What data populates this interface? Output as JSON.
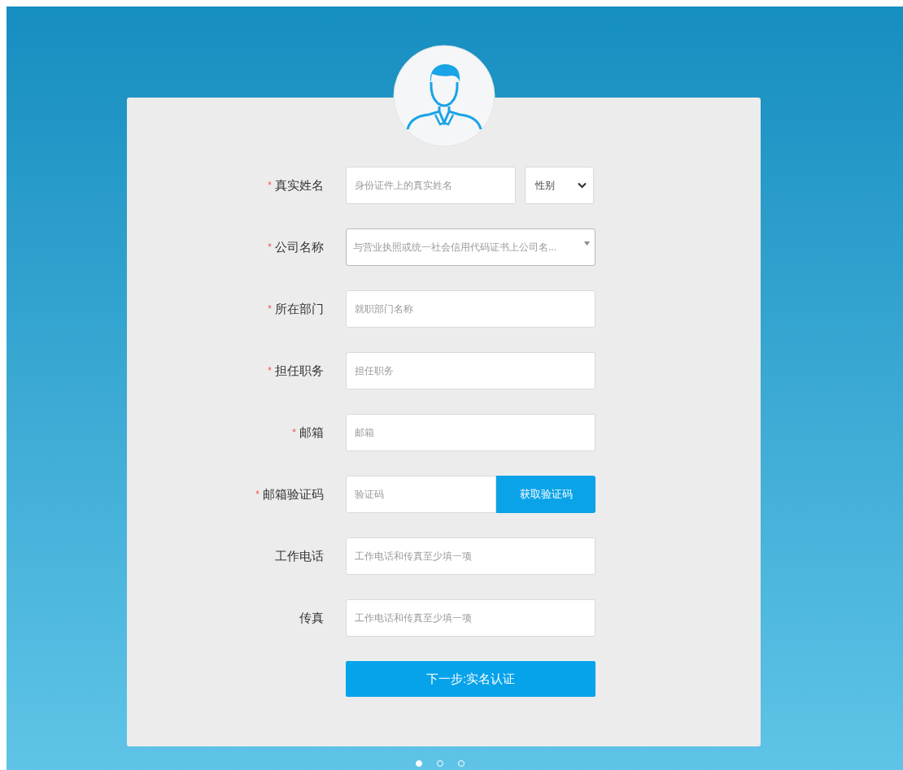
{
  "form": {
    "rows": [
      {
        "kind": "name",
        "marker": "*",
        "label": "真实姓名",
        "placeholder": "身份证件上的真实姓名",
        "select": "性别"
      },
      {
        "kind": "combo",
        "marker": "*",
        "label": "公司名称",
        "placeholder": "与营业执照或统一社会信用代码证书上公司名..."
      },
      {
        "kind": "text",
        "marker": "*",
        "label": "所在部门",
        "placeholder": "就职部门名称"
      },
      {
        "kind": "text",
        "marker": "*",
        "label": "担任职务",
        "placeholder": "担任职务"
      },
      {
        "kind": "text",
        "marker": "*",
        "label": "邮箱",
        "placeholder": "邮箱"
      },
      {
        "kind": "code",
        "marker": "*",
        "label": "邮箱验证码",
        "placeholder": "验证码",
        "button": "获取验证码"
      },
      {
        "kind": "text",
        "label": "工作电话",
        "placeholder": "工作电话和传真至少填一项"
      },
      {
        "kind": "text",
        "label": "传真",
        "placeholder": "工作电话和传真至少填一项"
      }
    ],
    "submit": "下一步:实名认证"
  },
  "pager": [
    {
      "selected": true
    },
    {
      "selected": false
    },
    {
      "selected": false
    }
  ]
}
